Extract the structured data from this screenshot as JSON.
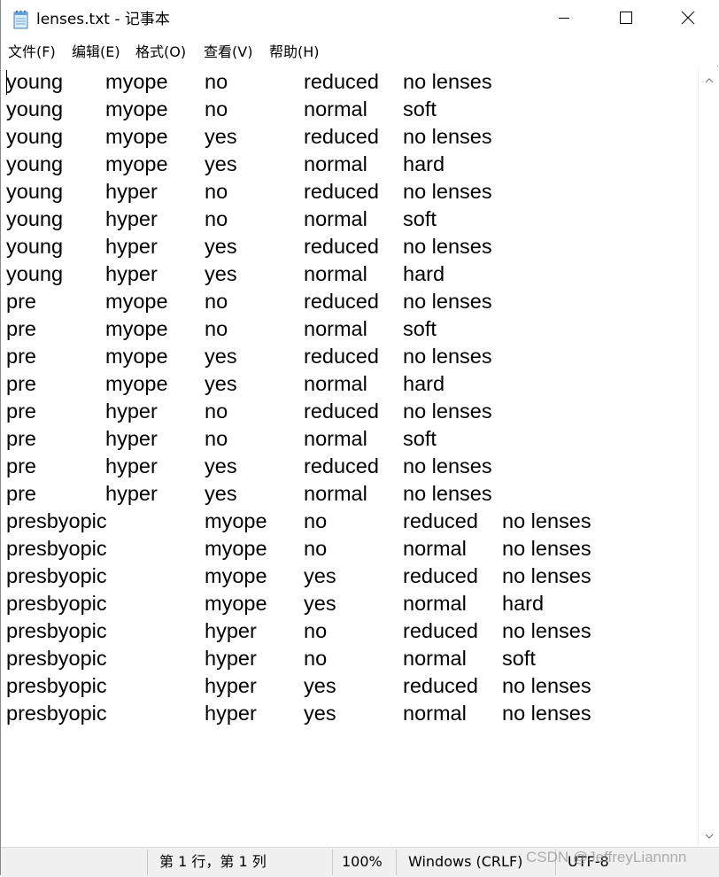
{
  "window": {
    "title": "lenses.txt - 记事本"
  },
  "menu": [
    {
      "label": "文件(F)"
    },
    {
      "label": "编辑(E)"
    },
    {
      "label": "格式(O)"
    },
    {
      "label": "查看(V)"
    },
    {
      "label": "帮助(H)"
    }
  ],
  "document": {
    "rows": [
      [
        "young",
        "myope",
        "no",
        "reduced",
        "no lenses"
      ],
      [
        "young",
        "myope",
        "no",
        "normal",
        "soft"
      ],
      [
        "young",
        "myope",
        "yes",
        "reduced",
        "no lenses"
      ],
      [
        "young",
        "myope",
        "yes",
        "normal",
        "hard"
      ],
      [
        "young",
        "hyper",
        "no",
        "reduced",
        "no lenses"
      ],
      [
        "young",
        "hyper",
        "no",
        "normal",
        "soft"
      ],
      [
        "young",
        "hyper",
        "yes",
        "reduced",
        "no lenses"
      ],
      [
        "young",
        "hyper",
        "yes",
        "normal",
        "hard"
      ],
      [
        "pre",
        "myope",
        "no",
        "reduced",
        "no lenses"
      ],
      [
        "pre",
        "myope",
        "no",
        "normal",
        "soft"
      ],
      [
        "pre",
        "myope",
        "yes",
        "reduced",
        "no lenses"
      ],
      [
        "pre",
        "myope",
        "yes",
        "normal",
        "hard"
      ],
      [
        "pre",
        "hyper",
        "no",
        "reduced",
        "no lenses"
      ],
      [
        "pre",
        "hyper",
        "no",
        "normal",
        "soft"
      ],
      [
        "pre",
        "hyper",
        "yes",
        "reduced",
        "no lenses"
      ],
      [
        "pre",
        "hyper",
        "yes",
        "normal",
        "no lenses"
      ],
      [
        "presbyopic",
        "myope",
        "no",
        "reduced",
        "no lenses"
      ],
      [
        "presbyopic",
        "myope",
        "no",
        "normal",
        "no lenses"
      ],
      [
        "presbyopic",
        "myope",
        "yes",
        "reduced",
        "no lenses"
      ],
      [
        "presbyopic",
        "myope",
        "yes",
        "normal",
        "hard"
      ],
      [
        "presbyopic",
        "hyper",
        "no",
        "reduced",
        "no lenses"
      ],
      [
        "presbyopic",
        "hyper",
        "no",
        "normal",
        "soft"
      ],
      [
        "presbyopic",
        "hyper",
        "yes",
        "reduced",
        "no lenses"
      ],
      [
        "presbyopic",
        "hyper",
        "yes",
        "normal",
        "no lenses"
      ]
    ]
  },
  "status": {
    "position": "第 1 行，第 1 列",
    "zoom": "100%",
    "line_ending": "Windows (CRLF)",
    "encoding": "UTF-8"
  },
  "watermark": "CSDN @JeffreyLiannnn",
  "icons": {
    "app": "notepad-icon",
    "minimize": "minimize-icon",
    "maximize": "maximize-icon",
    "close": "close-icon",
    "scroll_up": "chevron-up-icon",
    "scroll_down": "chevron-down-icon"
  }
}
